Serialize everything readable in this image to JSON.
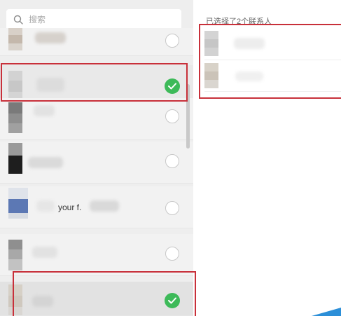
{
  "search": {
    "placeholder": "搜索"
  },
  "contacts": [
    {
      "name": "",
      "selected": false
    },
    {
      "name": "",
      "selected": true
    },
    {
      "name": "",
      "selected": false
    },
    {
      "name": "",
      "selected": false
    },
    {
      "name": "your f.",
      "selected": false
    },
    {
      "name": "",
      "selected": false
    },
    {
      "name": "",
      "selected": true
    }
  ],
  "right_panel": {
    "selected_count_text": "已选择了2个联系人"
  },
  "colors": {
    "check_green": "#3dba59",
    "highlight_red": "#c8303a",
    "panel_gray": "#eeeeee"
  }
}
